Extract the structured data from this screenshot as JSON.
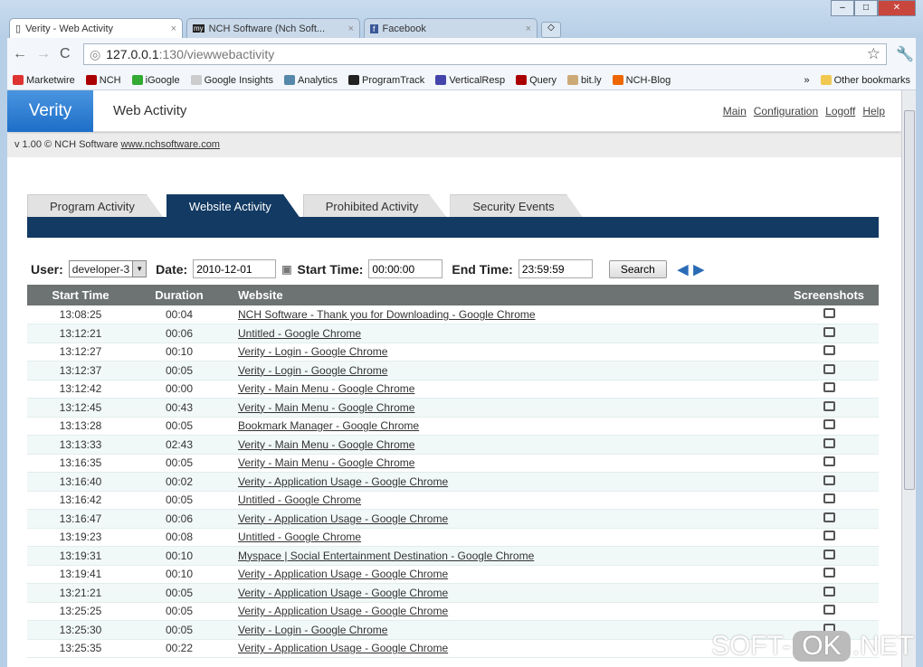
{
  "browser": {
    "tabs": [
      {
        "label": "Verity - Web Activity"
      },
      {
        "label": "NCH Software (Nch Soft..."
      },
      {
        "label": "Facebook"
      }
    ],
    "url_host": "127.0.0.1",
    "url_path": ":130/viewwebactivity",
    "bookmarks": [
      {
        "label": "Marketwire",
        "color": "#d33"
      },
      {
        "label": "NCH",
        "color": "#a00"
      },
      {
        "label": "iGoogle",
        "color": "#3a3"
      },
      {
        "label": "Google Insights",
        "color": "#ccc"
      },
      {
        "label": "Analytics",
        "color": "#58a"
      },
      {
        "label": "ProgramTrack",
        "color": "#222"
      },
      {
        "label": "VerticalResp",
        "color": "#44a"
      },
      {
        "label": "Query",
        "color": "#a00"
      },
      {
        "label": "bit.ly",
        "color": "#ca7"
      },
      {
        "label": "NCH-Blog",
        "color": "#e60"
      }
    ],
    "other_bookmarks": "Other bookmarks"
  },
  "header": {
    "logo": "Verity",
    "title": "Web Activity",
    "links": [
      "Main",
      "Configuration",
      "Logoff",
      "Help"
    ]
  },
  "version": {
    "text": "v 1.00 © NCH Software ",
    "link": "www.nchsoftware.com"
  },
  "tabs": [
    "Program Activity",
    "Website Activity",
    "Prohibited Activity",
    "Security Events"
  ],
  "filters": {
    "user_label": "User:",
    "user": "developer-3",
    "date_label": "Date:",
    "date": "2010-12-01",
    "start_label": "Start Time:",
    "start": "00:00:00",
    "end_label": "End Time:",
    "end": "23:59:59",
    "search": "Search"
  },
  "table": {
    "headers": [
      "Start Time",
      "Duration",
      "Website",
      "Screenshots"
    ],
    "rows": [
      [
        "13:08:25",
        "00:04",
        "NCH Software - Thank you for Downloading - Google Chrome"
      ],
      [
        "13:12:21",
        "00:06",
        "Untitled - Google Chrome"
      ],
      [
        "13:12:27",
        "00:10",
        "Verity - Login - Google Chrome"
      ],
      [
        "13:12:37",
        "00:05",
        "Verity - Login - Google Chrome"
      ],
      [
        "13:12:42",
        "00:00",
        "Verity - Main Menu - Google Chrome"
      ],
      [
        "13:12:45",
        "00:43",
        "Verity - Main Menu - Google Chrome"
      ],
      [
        "13:13:28",
        "00:05",
        "Bookmark Manager - Google Chrome"
      ],
      [
        "13:13:33",
        "02:43",
        "Verity - Main Menu - Google Chrome"
      ],
      [
        "13:16:35",
        "00:05",
        "Verity - Main Menu - Google Chrome"
      ],
      [
        "13:16:40",
        "00:02",
        "Verity - Application Usage - Google Chrome"
      ],
      [
        "13:16:42",
        "00:05",
        "Untitled - Google Chrome"
      ],
      [
        "13:16:47",
        "00:06",
        "Verity - Application Usage - Google Chrome"
      ],
      [
        "13:19:23",
        "00:08",
        "Untitled - Google Chrome"
      ],
      [
        "13:19:31",
        "00:10",
        "Myspace | Social Entertainment Destination - Google Chrome"
      ],
      [
        "13:19:41",
        "00:10",
        "Verity - Application Usage - Google Chrome"
      ],
      [
        "13:21:21",
        "00:05",
        "Verity - Application Usage - Google Chrome"
      ],
      [
        "13:25:25",
        "00:05",
        "Verity - Application Usage - Google Chrome"
      ],
      [
        "13:25:30",
        "00:05",
        "Verity - Login - Google Chrome"
      ],
      [
        "13:25:35",
        "00:22",
        "Verity - Application Usage - Google Chrome"
      ]
    ]
  },
  "watermark": {
    "a": "SOFT-",
    "b": "OK",
    ".c": "",
    "c": ".NET"
  }
}
